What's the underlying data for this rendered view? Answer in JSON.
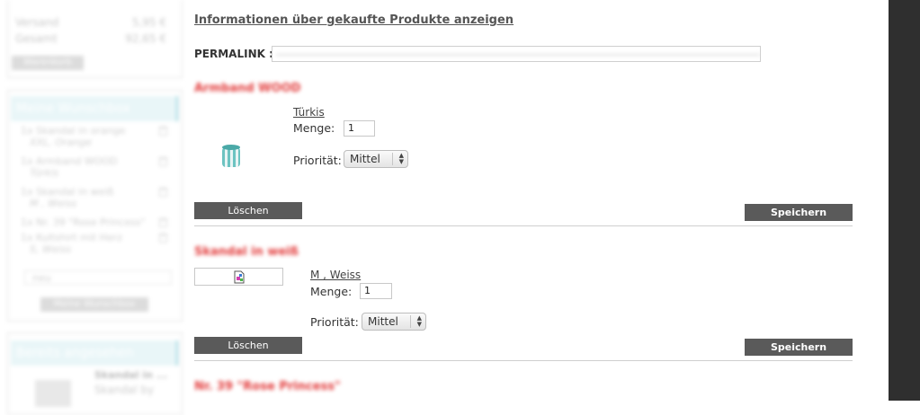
{
  "sidebar": {
    "cart": {
      "rows": [
        {
          "label": "Versand",
          "value": "5,95 €"
        },
        {
          "label": "Gesamt",
          "value": "92,65 €"
        }
      ],
      "button": "Warenkorb"
    },
    "wishbox": {
      "title": "Meine Wunschbox",
      "items": [
        {
          "name": "1x Skandal in orange",
          "detail": "XXL, Orange"
        },
        {
          "name": "1x Armband WOOD",
          "detail": "Türkis"
        },
        {
          "name": "1x Skandal in weiß",
          "detail": "M , Weiss"
        },
        {
          "name": "1x Nr. 39 \"Rose Princess\"",
          "detail": ""
        },
        {
          "name": "1x Kultshirt mit Herz",
          "detail": "S, Weiss"
        }
      ],
      "select_value": "neu",
      "button": "Meine Wunschbox"
    },
    "seen": {
      "title": "Bereits angesehen",
      "item_title": "Skandal in ...",
      "item_line": "Skandal by"
    }
  },
  "main": {
    "info_link": "Informationen über gekaufte Produkte anzeigen",
    "permalink_label": "PERMALINK :",
    "products": [
      {
        "title": "Armband WOOD",
        "variant": "Türkis",
        "qty_label": "Menge:",
        "qty": "1",
        "prio_label": "Priorität:",
        "prio": "Mittel",
        "delete": "Löschen",
        "save": "Speichern"
      },
      {
        "title": "Skandal in weiß",
        "variant": "M , Weiss",
        "qty_label": "Menge:",
        "qty": "1",
        "prio_label": "Priorität:",
        "prio": "Mittel",
        "delete": "Löschen",
        "save": "Speichern"
      },
      {
        "title": "Nr. 39 \"Rose Princess\""
      }
    ]
  },
  "colors": {
    "accent_red": "#e23b3b",
    "button_dark": "#5a5a5a",
    "wish_title_bg": "#e9f6f8"
  }
}
